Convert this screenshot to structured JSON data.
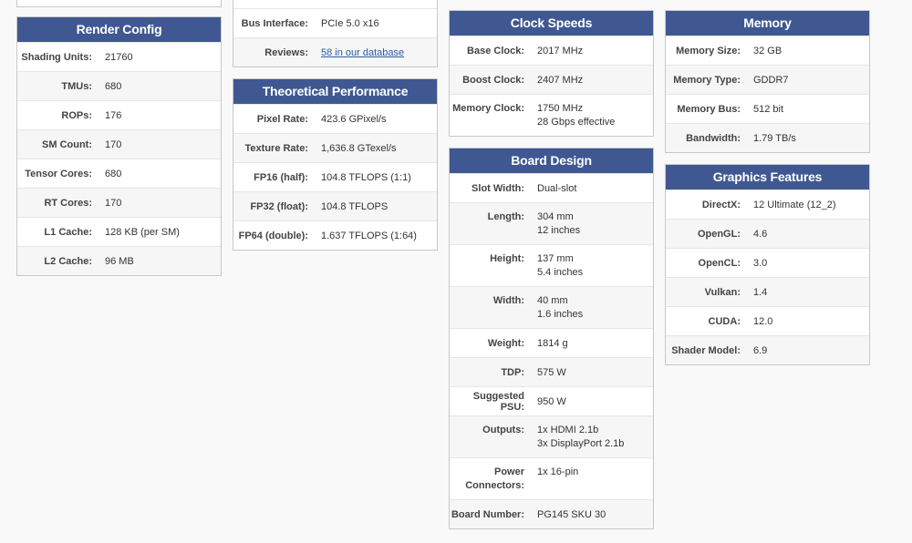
{
  "render_config": {
    "title": "Render Config",
    "rows": [
      {
        "label": "Shading Units:",
        "value": "21760"
      },
      {
        "label": "TMUs:",
        "value": "680"
      },
      {
        "label": "ROPs:",
        "value": "176"
      },
      {
        "label": "SM Count:",
        "value": "170"
      },
      {
        "label": "Tensor Cores:",
        "value": "680"
      },
      {
        "label": "RT Cores:",
        "value": "170"
      },
      {
        "label": "L1 Cache:",
        "value": "128 KB (per SM)"
      },
      {
        "label": "L2 Cache:",
        "value": "96 MB"
      }
    ]
  },
  "bus_box": {
    "rows": [
      {
        "label": "Bus Interface:",
        "value": "PCIe 5.0 x16"
      },
      {
        "label": "Reviews:",
        "value": "58 in our database"
      }
    ]
  },
  "theoretical_performance": {
    "title": "Theoretical Performance",
    "rows": [
      {
        "label": "Pixel Rate:",
        "value": "423.6 GPixel/s"
      },
      {
        "label": "Texture Rate:",
        "value": "1,636.8 GTexel/s"
      },
      {
        "label": "FP16 (half):",
        "value": "104.8 TFLOPS (1:1)"
      },
      {
        "label": "FP32 (float):",
        "value": "104.8 TFLOPS"
      },
      {
        "label": "FP64 (double):",
        "value": "1.637 TFLOPS (1:64)"
      }
    ]
  },
  "clock_speeds": {
    "title": "Clock Speeds",
    "rows": [
      {
        "label": "Base Clock:",
        "value": "2017 MHz"
      },
      {
        "label": "Boost Clock:",
        "value": "2407 MHz"
      },
      {
        "label": "Memory Clock:",
        "value": "1750 MHz",
        "value2": "28 Gbps effective"
      }
    ]
  },
  "board_design": {
    "title": "Board Design",
    "rows": [
      {
        "label": "Slot Width:",
        "value": "Dual-slot"
      },
      {
        "label": "Length:",
        "value": "304 mm",
        "value2": "12 inches"
      },
      {
        "label": "Height:",
        "value": "137 mm",
        "value2": "5.4 inches"
      },
      {
        "label": "Width:",
        "value": "40 mm",
        "value2": "1.6 inches"
      },
      {
        "label": "Weight:",
        "value": "1814 g"
      },
      {
        "label": "TDP:",
        "value": "575 W"
      },
      {
        "label": "Suggested PSU:",
        "value": "950 W"
      },
      {
        "label": "Outputs:",
        "value": "1x HDMI 2.1b",
        "value2": "3x DisplayPort 2.1b"
      },
      {
        "label": "Power",
        "label2": "Connectors:",
        "value": "1x 16-pin"
      },
      {
        "label": "Board Number:",
        "value": "PG145 SKU 30"
      }
    ]
  },
  "memory": {
    "title": "Memory",
    "rows": [
      {
        "label": "Memory Size:",
        "value": "32 GB"
      },
      {
        "label": "Memory Type:",
        "value": "GDDR7"
      },
      {
        "label": "Memory Bus:",
        "value": "512 bit"
      },
      {
        "label": "Bandwidth:",
        "value": "1.79 TB/s"
      }
    ]
  },
  "graphics_features": {
    "title": "Graphics Features",
    "rows": [
      {
        "label": "DirectX:",
        "value": "12 Ultimate (12_2)"
      },
      {
        "label": "OpenGL:",
        "value": "4.6"
      },
      {
        "label": "OpenCL:",
        "value": "3.0"
      },
      {
        "label": "Vulkan:",
        "value": "1.4"
      },
      {
        "label": "CUDA:",
        "value": "12.0"
      },
      {
        "label": "Shader Model:",
        "value": "6.9"
      }
    ]
  },
  "colors": {
    "header_bg": "#3f5892",
    "header_text": "#ffffff",
    "link": "#2b5aa8"
  }
}
